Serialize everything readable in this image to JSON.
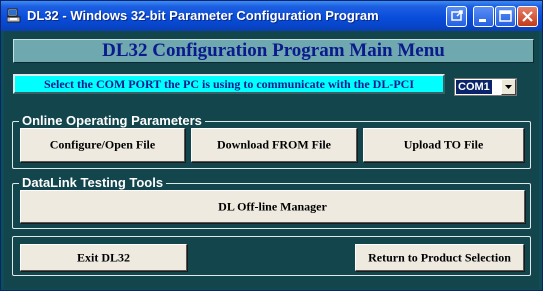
{
  "window": {
    "title": "DL32 - Windows 32-bit Parameter Configuration Program",
    "app_icon": "printer-computer-icon",
    "caption_buttons": [
      "restore-icon",
      "minimize-icon",
      "maximize-icon",
      "close-icon"
    ]
  },
  "header": {
    "title": "DL32 Configuration Program Main Menu"
  },
  "com_port": {
    "label": "Select the COM PORT the PC is using to communicate with the DL-PCI",
    "selected": "COM1"
  },
  "online_group": {
    "title": "Online Operating Parameters",
    "configure_label": "Configure/Open File",
    "download_label": "Download FROM File",
    "upload_label": "Upload TO File"
  },
  "testing_group": {
    "title": "DataLink Testing Tools",
    "offline_label": "DL Off-line Manager"
  },
  "footer": {
    "exit_label": "Exit DL32",
    "return_label": "Return to Product Selection"
  },
  "colors": {
    "window_bg": "#13454d",
    "header_bg": "#6fa8af",
    "header_text": "#0b1a8c",
    "com_label_bg": "#00ffff",
    "button_bg": "#eeeae0"
  }
}
